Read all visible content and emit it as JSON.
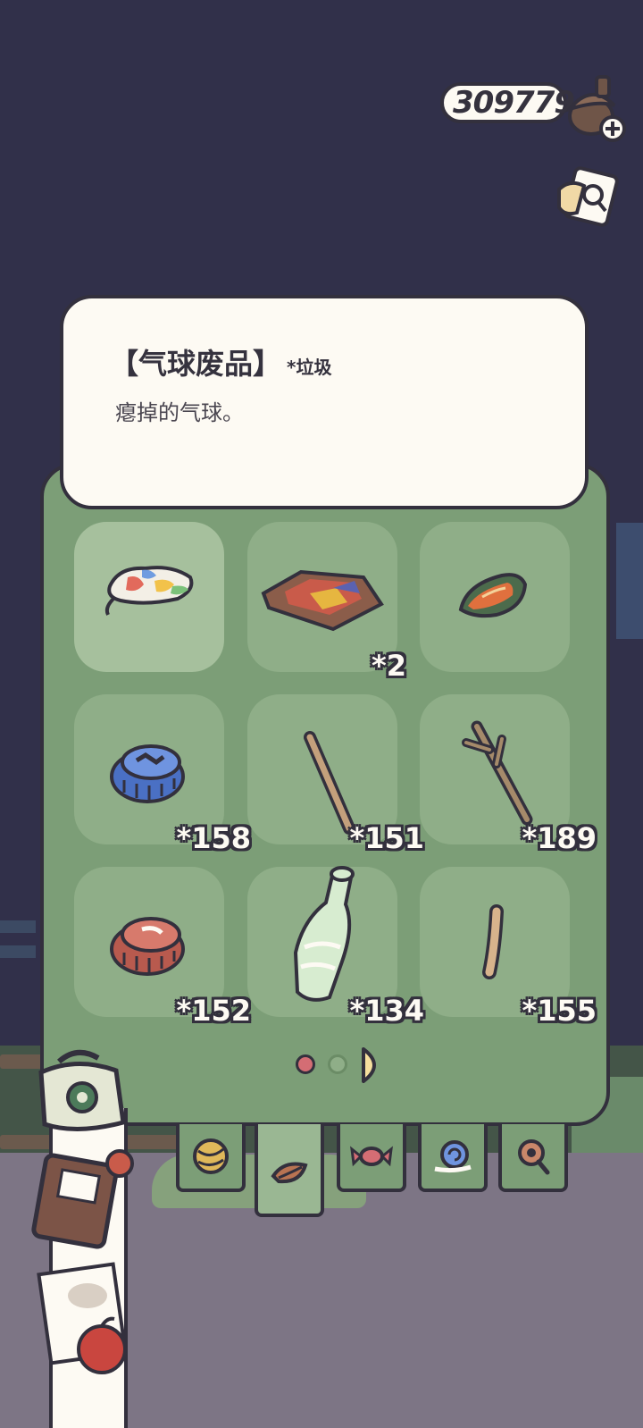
{
  "currency": {
    "amount": "309779",
    "icon": "acorn-icon",
    "add_icon": "plus-icon"
  },
  "notebook_icon": "notebook-icon",
  "item_info": {
    "name": "【气球废品】",
    "tag": "*垃圾",
    "description": "瘪掉的气球。"
  },
  "inventory": {
    "slots": [
      {
        "item": "deflated-balloon",
        "count": "",
        "selected": true
      },
      {
        "item": "crushed-box",
        "count": "*2"
      },
      {
        "item": "leaf-item",
        "count": ""
      },
      {
        "item": "blue-bottle-cap",
        "count": "*158"
      },
      {
        "item": "wooden-stick",
        "count": "*151"
      },
      {
        "item": "twig",
        "count": "*189"
      },
      {
        "item": "red-bottle-cap",
        "count": "*152"
      },
      {
        "item": "plastic-bottle",
        "count": "*134"
      },
      {
        "item": "small-stick",
        "count": "*155"
      }
    ],
    "pages": {
      "total": 3,
      "current": 1
    }
  },
  "categories": [
    {
      "name": "yarn-ball-icon",
      "active": false
    },
    {
      "name": "leaf-icon",
      "active": true
    },
    {
      "name": "candy-icon",
      "active": false
    },
    {
      "name": "snail-icon",
      "active": false
    },
    {
      "name": "magnifier-icon",
      "active": false
    }
  ],
  "colors": {
    "background": "#31304a",
    "panel": "#7c9e77",
    "slot": "#8fae88",
    "card": "#fdfaf3",
    "outline": "#33303d"
  }
}
